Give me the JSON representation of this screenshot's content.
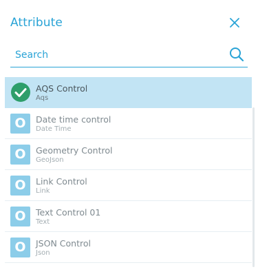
{
  "header": {
    "title": "Attribute",
    "close_icon": "close-icon"
  },
  "search": {
    "placeholder": "Search",
    "value": "",
    "icon": "search-icon"
  },
  "colors": {
    "accent": "#29a3d6",
    "selected_bg": "#c2e4f4",
    "badge_bg": "#8ccde9",
    "check_green": "#2e9e6a"
  },
  "items": [
    {
      "label": "AQS Control",
      "type": "Aqs",
      "icon": "check-circle-icon",
      "selected": true
    },
    {
      "label": "Date time control",
      "type": "Date Time",
      "icon": "o-badge-icon",
      "badge_glyph": "O",
      "selected": false
    },
    {
      "label": "Geometry Control",
      "type": "GeoJson",
      "icon": "o-badge-icon",
      "badge_glyph": "O",
      "selected": false
    },
    {
      "label": "Link Control",
      "type": "Link",
      "icon": "o-badge-icon",
      "badge_glyph": "O",
      "selected": false
    },
    {
      "label": "Text Control 01",
      "type": "Text",
      "icon": "o-badge-icon",
      "badge_glyph": "O",
      "selected": false
    },
    {
      "label": "JSON Control",
      "type": "Json",
      "icon": "o-badge-icon",
      "badge_glyph": "O",
      "selected": false
    }
  ]
}
